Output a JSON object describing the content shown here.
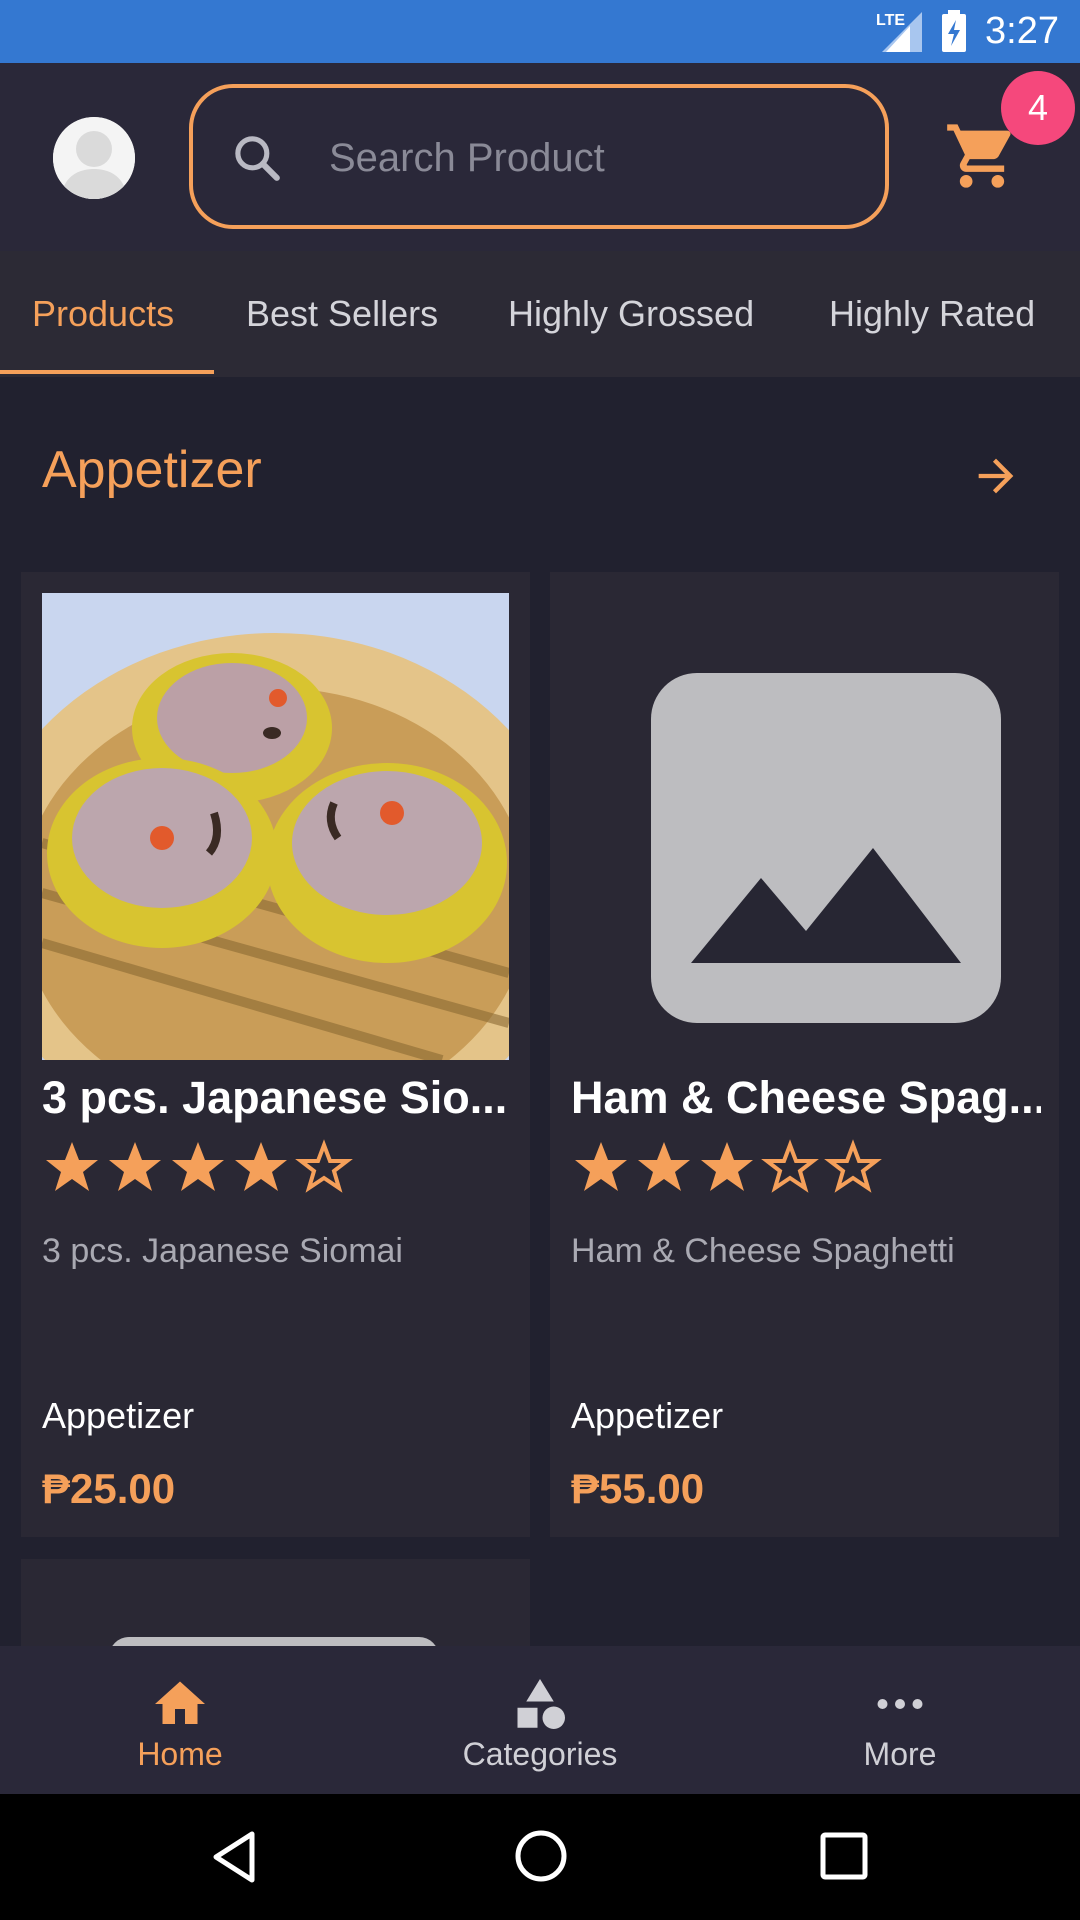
{
  "status_bar": {
    "network": "LTE",
    "time": "3:27"
  },
  "header": {
    "search": {
      "placeholder": "Search Product"
    },
    "cart_badge": "4"
  },
  "tabs": [
    {
      "label": "Products",
      "active": true
    },
    {
      "label": "Best Sellers",
      "active": false
    },
    {
      "label": "Highly Grossed",
      "active": false
    },
    {
      "label": "Highly Rated",
      "active": false
    }
  ],
  "section": {
    "title": "Appetizer"
  },
  "products": [
    {
      "name": "3 pcs. Japanese Sio...",
      "rating": 4,
      "rating_max": 5,
      "description": "3 pcs. Japanese Siomai",
      "category": "Appetizer",
      "price": "₱25.00"
    },
    {
      "name": "Ham & Cheese Spag...",
      "rating": 3,
      "rating_max": 5,
      "description": "Ham & Cheese Spaghetti",
      "category": "Appetizer",
      "price": "₱55.00"
    }
  ],
  "bottom_nav": [
    {
      "label": "Home",
      "icon": "home-icon",
      "active": true
    },
    {
      "label": "Categories",
      "icon": "categories-icon",
      "active": false
    },
    {
      "label": "More",
      "icon": "more-icon",
      "active": false
    }
  ],
  "colors": {
    "accent": "#f5a05a",
    "background": "#21212f",
    "card": "#2a2834",
    "badge": "#f5487c",
    "status_bar": "#3478d1"
  }
}
